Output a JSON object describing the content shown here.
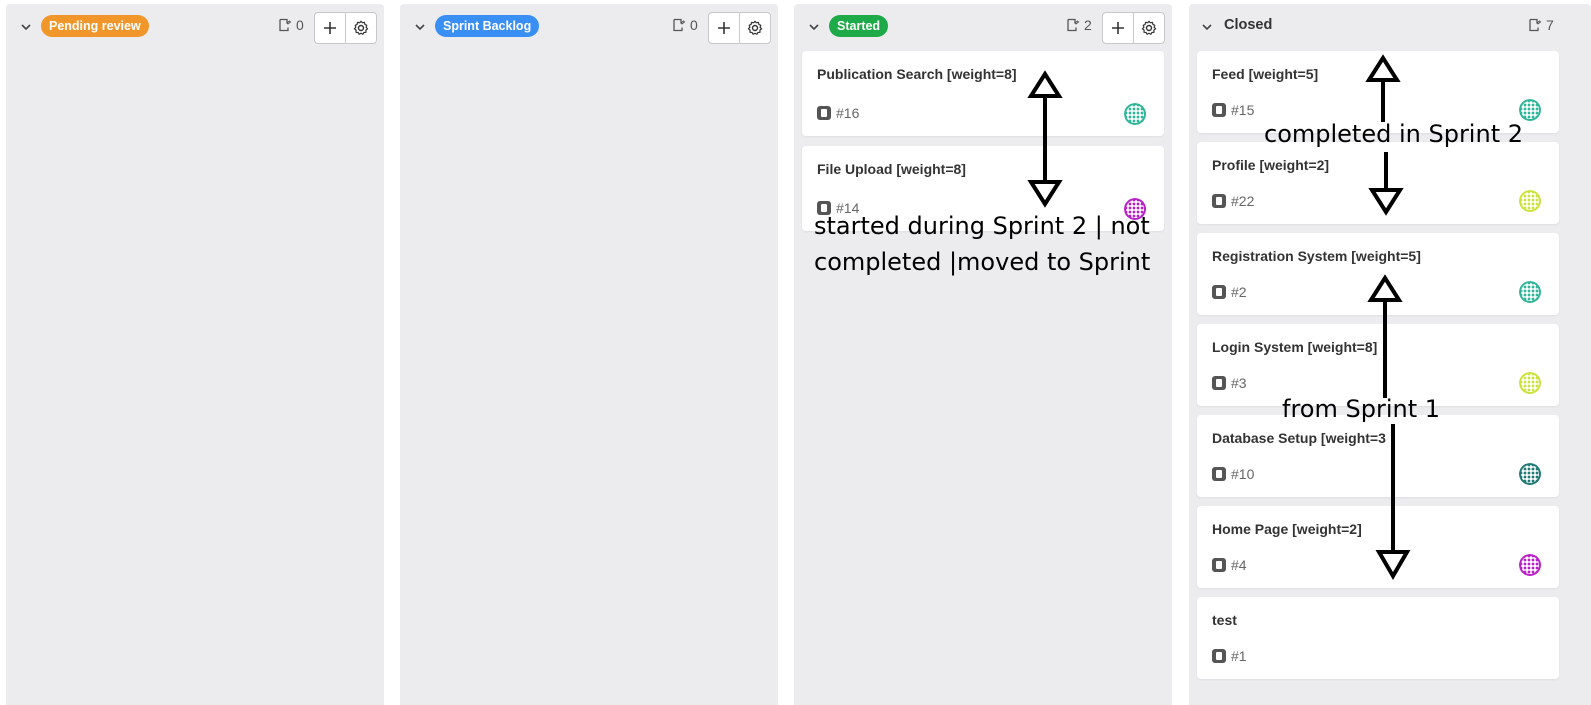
{
  "columns": [
    {
      "title": "Pending review",
      "badge_color": "#f0962a",
      "count": "0"
    },
    {
      "title": "Sprint Backlog",
      "badge_color": "#3a8ff5",
      "count": "0"
    },
    {
      "title": "Started",
      "badge_color": "#1faa4a",
      "count": "2"
    },
    {
      "title": "Closed",
      "count": "7"
    }
  ],
  "started_cards": [
    {
      "title": "Publication Search [weight=8]",
      "ref": "#16",
      "avatar_color": "#2fb59a"
    },
    {
      "title": "File Upload [weight=8]",
      "ref": "#14",
      "avatar_color": "#b71fc7"
    }
  ],
  "closed_cards": [
    {
      "title": "Feed [weight=5]",
      "ref": "#15",
      "avatar_color": "#2fb59a"
    },
    {
      "title": "Profile [weight=2]",
      "ref": "#22",
      "avatar_color": "#cbe33a"
    },
    {
      "title": "Registration System [weight=5]",
      "ref": "#2",
      "avatar_color": "#2fb59a"
    },
    {
      "title": "Login System [weight=8]",
      "ref": "#3",
      "avatar_color": "#cbe33a"
    },
    {
      "title": "Database Setup [weight=3",
      "ref": "#10",
      "avatar_color": "#1f7a75"
    },
    {
      "title": "Home Page [weight=2]",
      "ref": "#4",
      "avatar_color": "#b71fc7"
    },
    {
      "title": "test",
      "ref": "#1"
    }
  ],
  "annotations": {
    "started_line1": "started during Sprint 2 | not",
    "started_line2": "completed |moved to Sprint",
    "closed_top": "completed in Sprint 2",
    "closed_mid": "from Sprint 1"
  }
}
